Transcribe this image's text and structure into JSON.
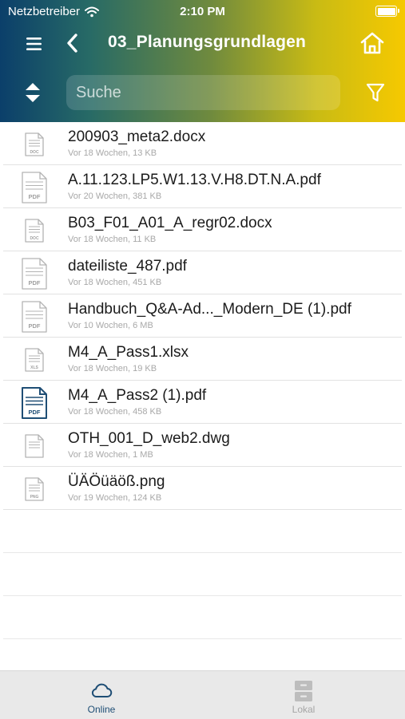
{
  "status_bar": {
    "carrier": "Netzbetreiber",
    "time": "2:10 PM"
  },
  "header": {
    "title": "03_Planungsgrundlagen"
  },
  "search": {
    "placeholder": "Suche",
    "value": ""
  },
  "files": [
    {
      "name": "200903_meta2.docx",
      "meta": "Vor 18 Wochen, 13 KB",
      "type": "DOC",
      "icon": "doc-file-icon",
      "active": false
    },
    {
      "name": "A.11.123.LP5.W1.13.V.H8.DT.N.A.pdf",
      "meta": "Vor 20 Wochen, 381 KB",
      "type": "PDF",
      "icon": "pdf-file-icon",
      "active": false
    },
    {
      "name": "B03_F01_A01_A_regr02.docx",
      "meta": "Vor 18 Wochen, 11 KB",
      "type": "DOC",
      "icon": "doc-file-icon",
      "active": false
    },
    {
      "name": "dateiliste_487.pdf",
      "meta": "Vor 18 Wochen, 451 KB",
      "type": "PDF",
      "icon": "pdf-file-icon",
      "active": false
    },
    {
      "name": "Handbuch_Q&A-Ad..._Modern_DE (1).pdf",
      "meta": "Vor 10 Wochen, 6 MB",
      "type": "PDF",
      "icon": "pdf-file-icon",
      "active": false
    },
    {
      "name": "M4_A_Pass1.xlsx",
      "meta": "Vor 18 Wochen, 19 KB",
      "type": "XLS",
      "icon": "xls-file-icon",
      "active": false
    },
    {
      "name": "M4_A_Pass2 (1).pdf",
      "meta": "Vor 18 Wochen, 458 KB",
      "type": "PDF",
      "icon": "pdf-file-icon",
      "active": true
    },
    {
      "name": "OTH_001_D_web2.dwg",
      "meta": "Vor 18 Wochen, 1 MB",
      "type": "",
      "icon": "generic-file-icon",
      "active": false
    },
    {
      "name": "ÜÄÖüäöß.png",
      "meta": "Vor 19 Wochen, 124 KB",
      "type": "PNG",
      "icon": "png-file-icon",
      "active": false
    }
  ],
  "tabbar": {
    "tabs": [
      {
        "label": "Online",
        "icon": "cloud-icon",
        "active": true
      },
      {
        "label": "Lokal",
        "icon": "storage-icon",
        "active": false
      }
    ]
  },
  "colors": {
    "header_gradient_start": "#0b3f6a",
    "header_gradient_end": "#f6c900",
    "active_accent": "#1f4e75",
    "inactive_icon": "#bdbdbd"
  }
}
